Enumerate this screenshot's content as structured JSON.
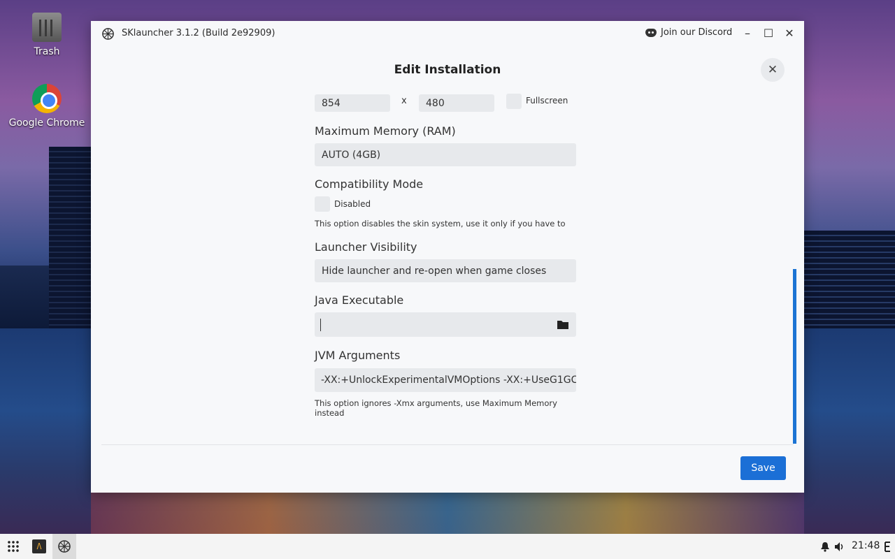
{
  "desktop": {
    "icons": [
      {
        "label": "Trash"
      },
      {
        "label": "Google Chrome"
      }
    ]
  },
  "window": {
    "title": "SKlauncher 3.1.2 (Build 2e92909)",
    "discord_label": "Join our Discord",
    "minimize": "–",
    "maximize": "☐",
    "close": "✕"
  },
  "dialog": {
    "title": "Edit Installation",
    "close_glyph": "✕",
    "resolution": {
      "width": "854",
      "separator": "x",
      "height": "480",
      "fullscreen_label": "Fullscreen"
    },
    "memory": {
      "label": "Maximum Memory (RAM)",
      "value": "AUTO (4GB)"
    },
    "compatibility": {
      "label": "Compatibility Mode",
      "checkbox_label": "Disabled",
      "hint": "This option disables the skin system, use it only if you have to"
    },
    "visibility": {
      "label": "Launcher Visibility",
      "value": "Hide launcher and re-open when game closes"
    },
    "java": {
      "label": "Java Executable",
      "value": "",
      "browse_icon": "folder-icon"
    },
    "jvm": {
      "label": "JVM Arguments",
      "value": "-XX:+UnlockExperimentalVMOptions -XX:+UseG1GC",
      "hint": "This option ignores -Xmx arguments, use Maximum Memory instead"
    },
    "save_label": "Save"
  },
  "taskbar": {
    "clock": "21:48",
    "icons": [
      "apps-grid-icon",
      "terminal-icon",
      "sklauncher-icon",
      "bell-icon",
      "volume-icon",
      "power-icon"
    ]
  },
  "colors": {
    "accent": "#1b6fd6",
    "field_bg": "#e7e9ec",
    "window_bg": "#f7f8fa"
  }
}
